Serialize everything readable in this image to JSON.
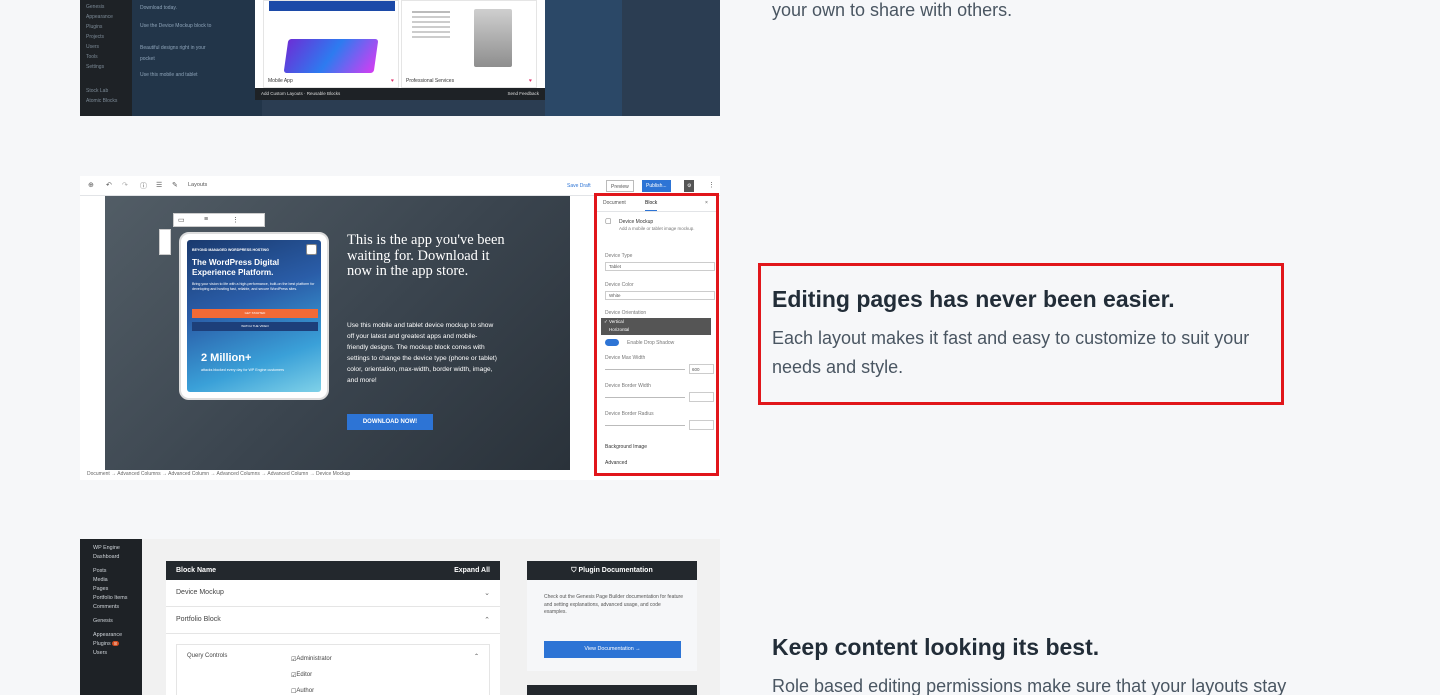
{
  "section_top": {
    "text": "your own to share with others."
  },
  "section_editing": {
    "title": "Editing pages has never been easier.",
    "body": "Each layout makes it fast and easy to customize to suit your needs and style."
  },
  "section_content": {
    "title": "Keep content looking its best.",
    "body": "Role based editing permissions make sure that your layouts stay"
  },
  "shot1": {
    "sidebar": [
      "Genesis",
      "Appearance",
      "Plugins",
      "Projects",
      "Users",
      "Tools",
      "Settings",
      "Stock Lab",
      "Atomic Blocks"
    ],
    "dark_text": [
      "Download today.",
      "Use the Device Mockup block to",
      "Beautiful designs right in your",
      "pocket",
      "Use this mobile and tablet"
    ],
    "card_left": "Mobile App",
    "card_right": "Professional Services",
    "bar_left": "Add Custom Layouts · Reusable Blocks",
    "bar_right": "Send Feedback"
  },
  "shot2": {
    "toolbar_layouts": "Layouts",
    "save_draft": "Save Draft",
    "preview": "Preview",
    "publish": "Publish...",
    "ipad_tag": "BEYOND MANAGED WORDPRESS HOSTING",
    "ipad_headline": "The WordPress Digital Experience Platform.",
    "ipad_body": "Bring your vision to life with a high-performance, built-on the best platform for developing and hosting fast, reliable, and secure WordPress sites.",
    "ipad_btn1": "GET STARTED",
    "ipad_btn2": "WATCH THE VIDEO",
    "ipad_big": "2 Million+",
    "ipad_sub": "attacks blocked every day for WP Engine customers",
    "title": "This is the app you've been waiting for. Download it now in the app store.",
    "text": "Use this mobile and tablet device mockup to show off your latest and greatest apps and mobile-friendly designs. The mockup block comes with settings to change the device type (phone or tablet) color, orientation, max-width, border width, image, and more!",
    "download": "DOWNLOAD NOW!",
    "panel": {
      "tab_document": "Document",
      "tab_block": "Block",
      "block_name": "Device Mockup",
      "block_desc": "Add a mobile or tablet image mockup.",
      "device_type_label": "Device Type",
      "device_type_value": "Tablet",
      "device_color_label": "Device Color",
      "device_color_value": "White",
      "orientation_label": "Device Orientation",
      "orientation_vertical": "✓ Vertical",
      "orientation_horizontal": "Horizontal",
      "drop_shadow": "Enable Drop Shadow",
      "max_width_label": "Device Max Width",
      "max_width_value": "600",
      "border_width_label": "Device Border Width",
      "border_radius_label": "Device Border Radius",
      "background_image": "Background Image",
      "advanced": "Advanced"
    },
    "breadcrumbs": "Document  →  Advanced Columns  →  Advanced Column  →  Advanced Columns  →  Advanced Column  →  Device Mockup"
  },
  "shot3": {
    "sidebar": [
      "WP Engine",
      "Dashboard",
      "Posts",
      "Media",
      "Pages",
      "Portfolio Items",
      "Comments",
      "Genesis",
      "Appearance",
      "Plugins",
      "Users"
    ],
    "plugins_badge": "8",
    "table_head_left": "Block Name",
    "table_head_right": "Expand All",
    "row1": "Device Mockup",
    "row2": "Portfolio Block",
    "query_controls": "Query Controls",
    "perm1": "Administrator",
    "perm2": "Editor",
    "perm3": "Author",
    "doc_title": "Plugin Documentation",
    "doc_text": "Check out the Genesis Page Builder documentation for feature and setting explanations, advanced usage, and code examples.",
    "doc_button": "View Documentation →"
  }
}
